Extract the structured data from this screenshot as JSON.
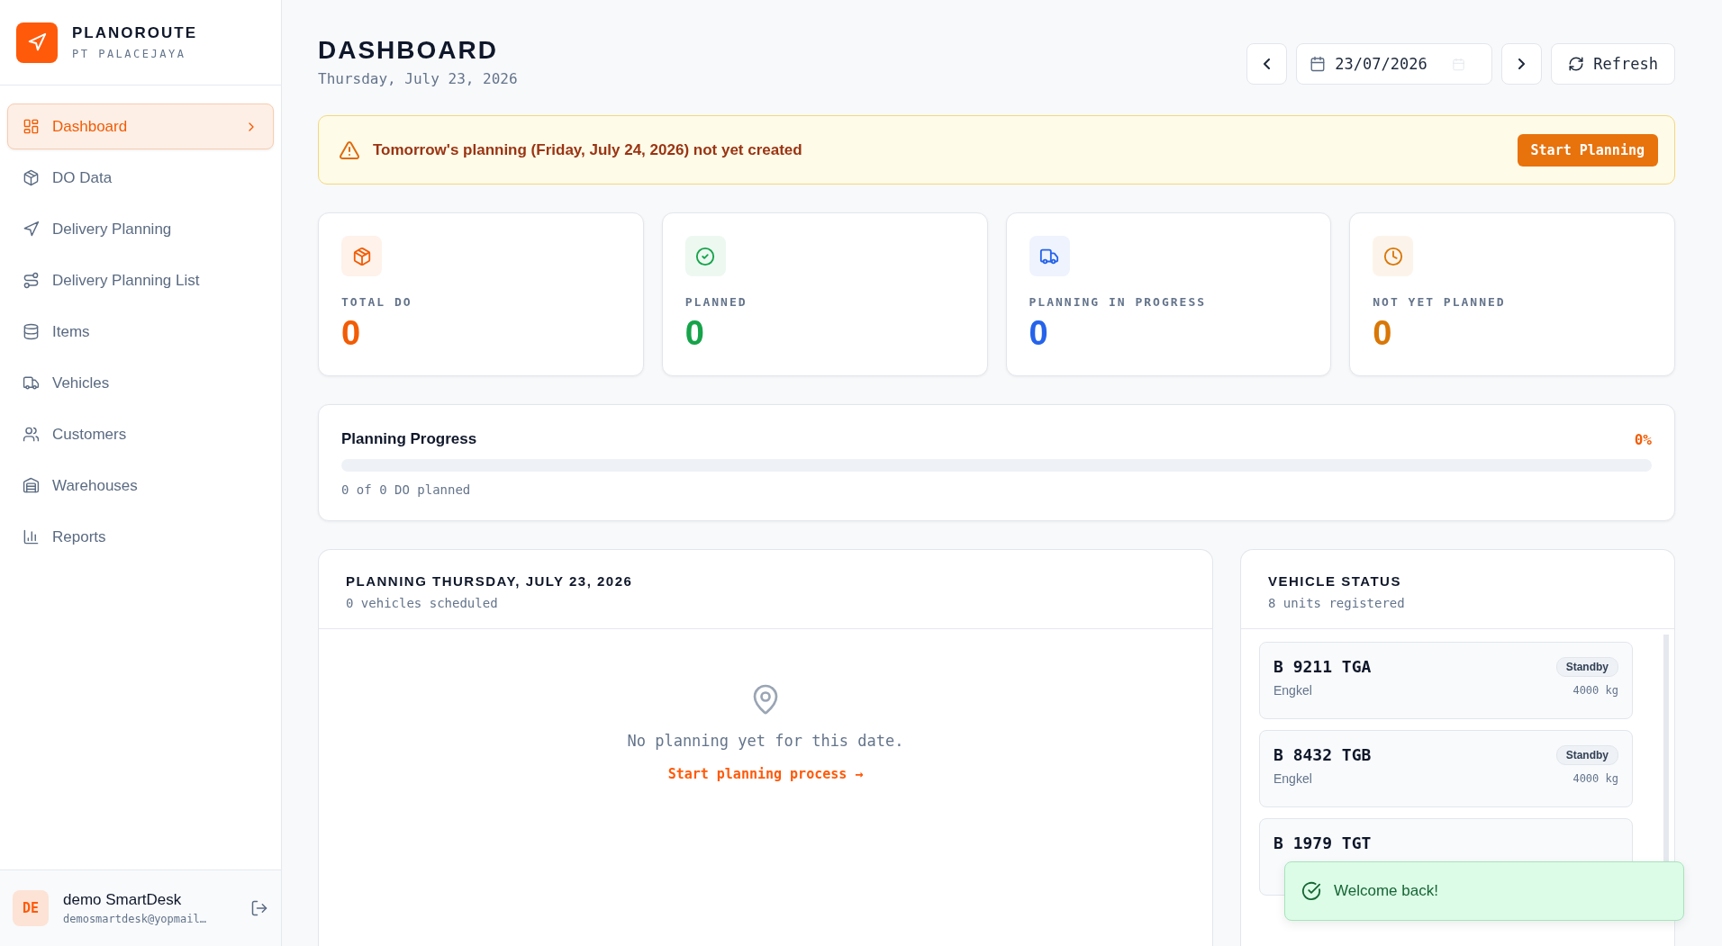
{
  "brand": {
    "name": "PLANOROUTE",
    "company": "PT PALACEJAYA"
  },
  "sidebar": {
    "items": [
      {
        "label": "Dashboard",
        "selected": true
      },
      {
        "label": "DO Data",
        "selected": false
      },
      {
        "label": "Delivery Planning",
        "selected": false
      },
      {
        "label": "Delivery Planning List",
        "selected": false
      },
      {
        "label": "Items",
        "selected": false
      },
      {
        "label": "Vehicles",
        "selected": false
      },
      {
        "label": "Customers",
        "selected": false
      },
      {
        "label": "Warehouses",
        "selected": false
      },
      {
        "label": "Reports",
        "selected": false
      }
    ]
  },
  "user": {
    "initials": "DE",
    "name": "demo SmartDesk",
    "email": "demosmartdesk@yopmail…"
  },
  "header": {
    "title": "DASHBOARD",
    "date": "Thursday, July 23, 2026",
    "date_value": "23/07/2026",
    "refresh": "Refresh"
  },
  "alert": {
    "message": "Tomorrow's planning (Friday, July 24, 2026) not yet created",
    "button": "Start Planning"
  },
  "stats": [
    {
      "label": "TOTAL DO",
      "value": "0",
      "color": "#f25c05"
    },
    {
      "label": "PLANNED",
      "value": "0",
      "color": "#16a34a"
    },
    {
      "label": "PLANNING IN PROGRESS",
      "value": "0",
      "color": "#2563eb"
    },
    {
      "label": "NOT YET PLANNED",
      "value": "0",
      "color": "#d97706"
    }
  ],
  "progress": {
    "title": "Planning Progress",
    "percent": "0%",
    "level": 0,
    "caption": "0 of 0 DO planned"
  },
  "planning": {
    "title": "PLANNING THURSDAY, JULY 23, 2026",
    "subtitle": "0 vehicles scheduled",
    "empty": "No planning yet for this date.",
    "link": "Start planning process →"
  },
  "vehicle_status": {
    "title": "VEHICLE STATUS",
    "subtitle": "8 units registered",
    "vehicles": [
      {
        "plate": "B 9211 TGA",
        "type": "Engkel",
        "status": "Standby",
        "capacity": "4000 kg"
      },
      {
        "plate": "B 8432 TGB",
        "type": "Engkel",
        "status": "Standby",
        "capacity": "4000 kg"
      },
      {
        "plate": "B 1979 TGT"
      }
    ]
  },
  "toast": {
    "message": "Welcome back!"
  }
}
